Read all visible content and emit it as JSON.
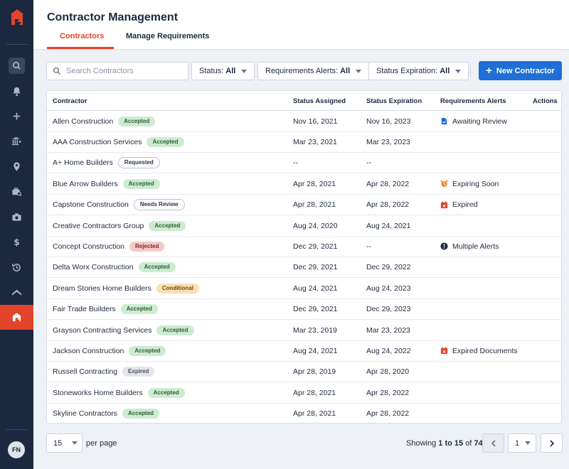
{
  "header": {
    "title": "Contractor Management",
    "tabs": [
      {
        "label": "Contractors",
        "active": true
      },
      {
        "label": "Manage Requirements",
        "active": false
      }
    ]
  },
  "sidebar": {
    "icons": [
      "logo-icon",
      "search-icon",
      "bell-icon",
      "plus-icon",
      "bank-transfer-icon",
      "location-pin-icon",
      "briefcase-search-icon",
      "camera-icon",
      "dollar-icon",
      "history-icon",
      "roof-icon",
      "contractor-house-icon"
    ],
    "active": "contractor-house-icon",
    "avatar": "FN"
  },
  "toolbar": {
    "search_placeholder": "Search Contractors",
    "filters": [
      {
        "label": "Status:",
        "value": "All"
      },
      {
        "label": "Requirements Alerts:",
        "value": "All"
      },
      {
        "label": "Status Expiration:",
        "value": "All"
      }
    ],
    "new_button": "New Contractor"
  },
  "table": {
    "columns": [
      "Contractor",
      "Status Assigned",
      "Status Expiration",
      "Requirements Alerts",
      "Actions"
    ],
    "rows": [
      {
        "name": "Allen Construction",
        "badge": "Accepted",
        "assigned": "Nov 16, 2021",
        "expiration": "Nov 16, 2023",
        "alert": "Awaiting Review",
        "alert_icon": "document-icon"
      },
      {
        "name": "AAA Construction Services",
        "badge": "Accepted",
        "assigned": "Mar 23, 2021",
        "expiration": "Mar 23, 2023",
        "alert": "",
        "alert_icon": ""
      },
      {
        "name": "A+ Home Builders",
        "badge": "Requested",
        "assigned": "--",
        "expiration": "--",
        "alert": "",
        "alert_icon": ""
      },
      {
        "name": "Blue Arrow Builders",
        "badge": "Accepted",
        "assigned": "Apr 28, 2021",
        "expiration": "Apr 28, 2022",
        "alert": "Expiring Soon",
        "alert_icon": "alarm-clock-icon"
      },
      {
        "name": "Capstone Construction",
        "badge": "Needs Review",
        "assigned": "Apr 28, 2021",
        "expiration": "Apr 28, 2022",
        "alert": "Expired",
        "alert_icon": "calendar-x-icon"
      },
      {
        "name": "Creative Contractors Group",
        "badge": "Accepted",
        "assigned": "Aug 24, 2020",
        "expiration": "Aug 24, 2021",
        "alert": "",
        "alert_icon": ""
      },
      {
        "name": "Concept Construction",
        "badge": "Rejected",
        "assigned": "Dec 29, 2021",
        "expiration": "--",
        "alert": "Multiple Alerts",
        "alert_icon": "exclamation-circle-icon"
      },
      {
        "name": "Delta Worx Construction",
        "badge": "Accepted",
        "assigned": "Dec 29, 2021",
        "expiration": "Dec 29, 2022",
        "alert": "",
        "alert_icon": ""
      },
      {
        "name": "Dream Stories Home Builders",
        "badge": "Conditional",
        "assigned": "Aug 24, 2021",
        "expiration": "Aug 24, 2023",
        "alert": "",
        "alert_icon": ""
      },
      {
        "name": "Fair Trade Builders",
        "badge": "Accepted",
        "assigned": "Dec 29, 2021",
        "expiration": "Dec 29, 2023",
        "alert": "",
        "alert_icon": ""
      },
      {
        "name": "Grayson Contracting Services",
        "badge": "Accepted",
        "assigned": "Mar 23, 2019",
        "expiration": "Mar 23, 2023",
        "alert": "",
        "alert_icon": ""
      },
      {
        "name": "Jackson Construction",
        "badge": "Accepted",
        "assigned": "Aug 24, 2021",
        "expiration": "Aug 24, 2022",
        "alert": "Expired Documents",
        "alert_icon": "calendar-x-icon"
      },
      {
        "name": "Russell Contracting",
        "badge": "Expired",
        "assigned": "Apr 28, 2019",
        "expiration": "Apr 28, 2020",
        "alert": "",
        "alert_icon": ""
      },
      {
        "name": "Stoneworks Home Builders",
        "badge": "Accepted",
        "assigned": "Apr 28, 2021",
        "expiration": "Apr 28, 2022",
        "alert": "",
        "alert_icon": ""
      },
      {
        "name": "Skyline Contractors",
        "badge": "Accepted",
        "assigned": "Apr 28, 2021",
        "expiration": "Apr 28, 2022",
        "alert": "",
        "alert_icon": ""
      }
    ]
  },
  "footer": {
    "per_page_value": "15",
    "per_page_label": "per page",
    "showing_prefix": "Showing",
    "showing_range": "1 to 15",
    "showing_of": "of",
    "showing_total": "74",
    "page_value": "1"
  },
  "colors": {
    "brand": "#e2452b",
    "sidebar": "#1c2740",
    "primary": "#1f6fd6"
  }
}
